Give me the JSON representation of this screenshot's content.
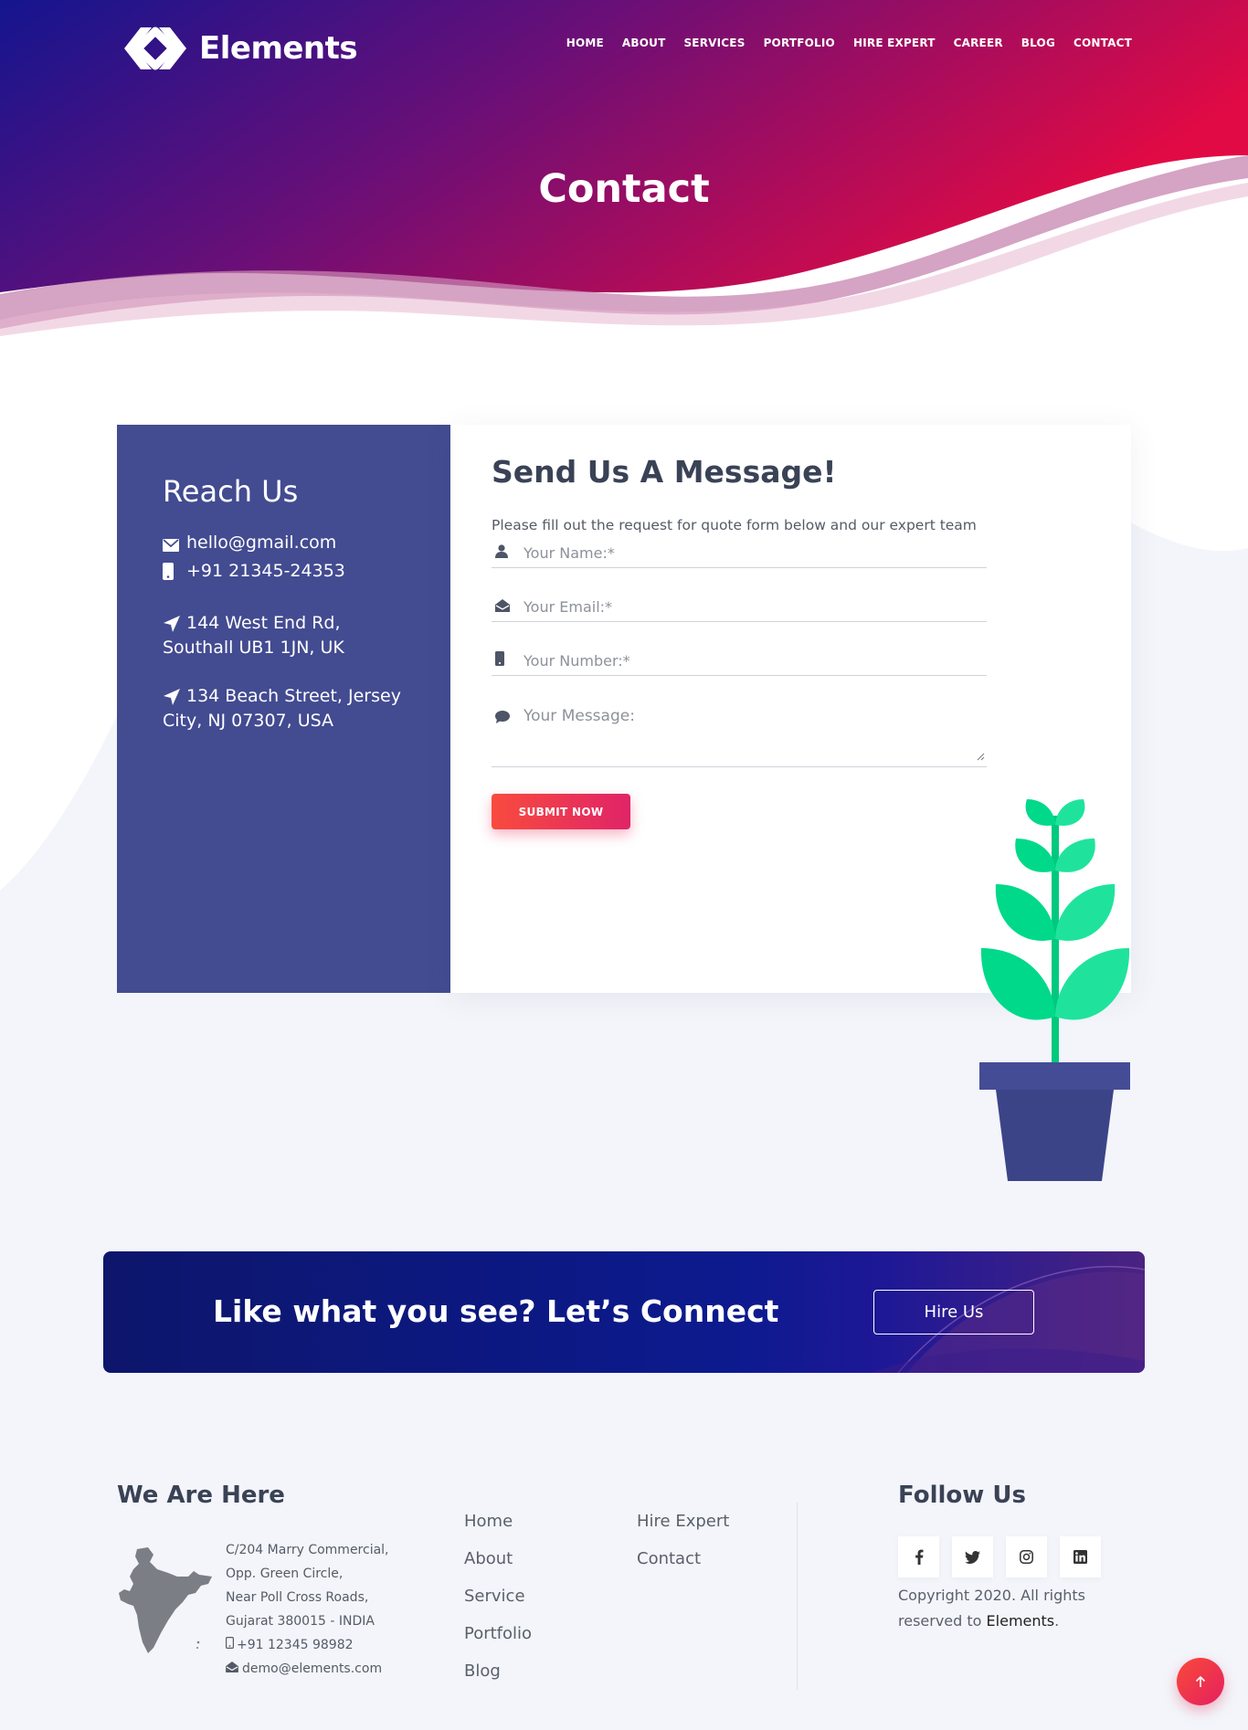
{
  "brand": {
    "name": "Elements"
  },
  "nav": [
    "HOME",
    "ABOUT",
    "SERVICES",
    "PORTFOLIO",
    "HIRE EXPERT",
    "CAREER",
    "BLOG",
    "CONTACT"
  ],
  "hero": {
    "title": "Contact"
  },
  "reach": {
    "title": "Reach Us",
    "email": "hello@gmail.com",
    "phone": "+91 21345-24353",
    "address1": "144 West End Rd, Southall UB1 1JN, UK",
    "address2": "134 Beach Street, Jersey City, NJ 07307, USA"
  },
  "form": {
    "title": "Send Us A Message!",
    "intro": "Please fill out the request for quote form below and our expert team will get back to you shortly.",
    "name_placeholder": "Your Name:*",
    "email_placeholder": "Your Email:*",
    "number_placeholder": "Your Number:*",
    "message_placeholder": "Your Message:",
    "submit_label": "SUBMIT NOW"
  },
  "cta": {
    "text": "Like what you see? Let’s Connect",
    "button": "Hire Us"
  },
  "footer": {
    "here_title": "We Are Here",
    "address_lines": [
      "C/204 Marry Commercial,",
      "Opp. Green Circle,",
      "Near Poll Cross Roads,",
      "Gujarat 380015 - INDIA"
    ],
    "phone": "+91 12345 98982",
    "email": "demo@elements.com",
    "links_col1": [
      "Home",
      "About",
      "Service",
      "Portfolio",
      "Blog"
    ],
    "links_col2": [
      "Hire Expert",
      "Contact"
    ],
    "follow_title": "Follow Us",
    "social_icons": [
      "facebook-icon",
      "twitter-icon",
      "instagram-icon",
      "linkedin-icon"
    ],
    "copyright_prefix": "Copyright 2020. All rights reserved to",
    "copyright_brand": "Elements",
    "copyright_suffix": "."
  },
  "colors": {
    "hero_start": "#14158f",
    "hero_end": "#e00a44",
    "reach_bg": "#434b91",
    "accent": "#f84b3e",
    "cta_bg": "#0c1a8e",
    "leaf": "#00d98a"
  }
}
